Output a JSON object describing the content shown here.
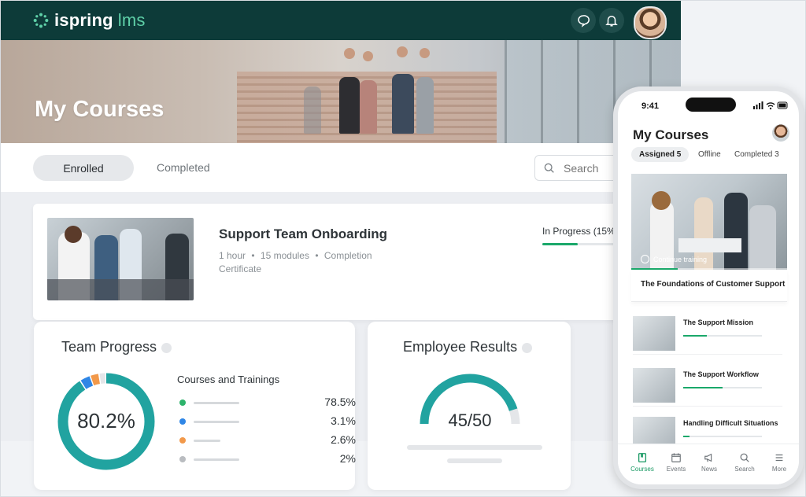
{
  "brand": {
    "name": "ispring",
    "suffix": "lms",
    "accent": "#5fd0a8",
    "header_bg": "#0d3b39",
    "progress_color": "#1aa86a"
  },
  "icons": {
    "chat": "chat-bubble-icon",
    "bell": "bell-icon",
    "search": "search-icon"
  },
  "hero": {
    "title": "My Courses"
  },
  "tabs": {
    "enrolled": "Enrolled",
    "completed": "Completed"
  },
  "search": {
    "placeholder": "Search"
  },
  "course": {
    "title": "Support Team Onboarding",
    "duration": "1 hour",
    "modules": "15 modules",
    "completion": "Completion Certificate",
    "status": "In Progress (15%)",
    "progress": 0.45
  },
  "team_progress": {
    "title": "Team Progress",
    "value": "80.2%",
    "legend_title": "Courses and Trainings",
    "items": [
      {
        "color": "#2db36b",
        "value": "78.5%",
        "share": 78.5
      },
      {
        "color": "#2f86e6",
        "value": "3.1%",
        "share": 3.1
      },
      {
        "color": "#f2994a",
        "value": "2.6%",
        "share": 2.6
      },
      {
        "color": "#b9bcc0",
        "value": "2%",
        "share": 2
      }
    ]
  },
  "employee_results": {
    "title": "Employee Results",
    "value": "45/50",
    "score": 45,
    "max": 50
  },
  "phone": {
    "time": "9:41",
    "title": "My Courses",
    "tabs": {
      "assigned": "Assigned 5",
      "offline": "Offline",
      "completed": "Completed 3"
    },
    "featured": {
      "continue": "Continue training",
      "title": "The Foundations of Customer Support",
      "progress": 0.3
    },
    "list": [
      {
        "name": "The Support Mission",
        "progress": 0.3
      },
      {
        "name": "The Support Workflow",
        "progress": 0.5
      },
      {
        "name": "Handling Difficult Situations",
        "progress": 0.08
      }
    ],
    "nav": {
      "courses": "Courses",
      "events": "Events",
      "news": "News",
      "search": "Search",
      "more": "More"
    }
  }
}
